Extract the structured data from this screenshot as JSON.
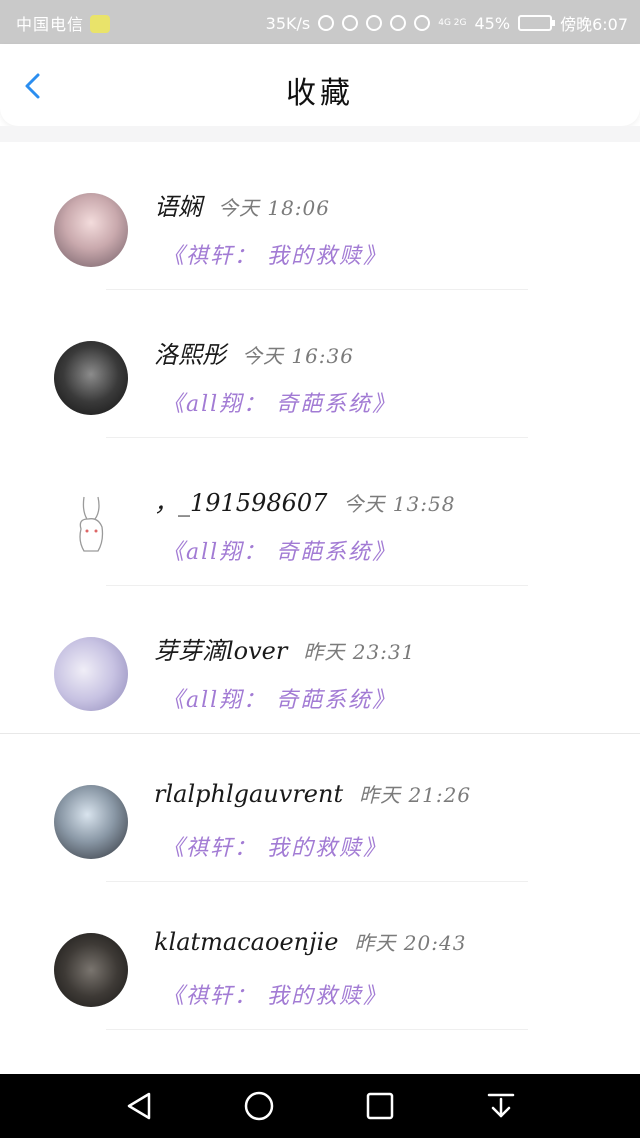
{
  "status_bar": {
    "carrier": "中国电信",
    "speed": "35K/s",
    "network": "4G 2G",
    "battery": "45%",
    "time": "傍晚6:07"
  },
  "header": {
    "title": "收藏"
  },
  "items": [
    {
      "name": "语娴",
      "time": "今天 18:06",
      "book": "《祺轩：  我的救赎》"
    },
    {
      "name": "洛熙彤",
      "time": "今天 16:36",
      "book": "《all翔：  奇葩系统》"
    },
    {
      "name": "，_191598607",
      "time": "今天 13:58",
      "book": "《all翔：  奇葩系统》"
    },
    {
      "name": "芽芽滴lover",
      "time": "昨天 23:31",
      "book": "《all翔：  奇葩系统》"
    },
    {
      "name": "rlalphlgauvrent",
      "time": "昨天 21:26",
      "book": "《祺轩：  我的救赎》"
    },
    {
      "name": "klatmacaoenjie",
      "time": "昨天 20:43",
      "book": "《祺轩：  我的救赎》"
    }
  ],
  "colors": {
    "accent": "#2b8ef0",
    "book_title": "#a27bd4"
  }
}
